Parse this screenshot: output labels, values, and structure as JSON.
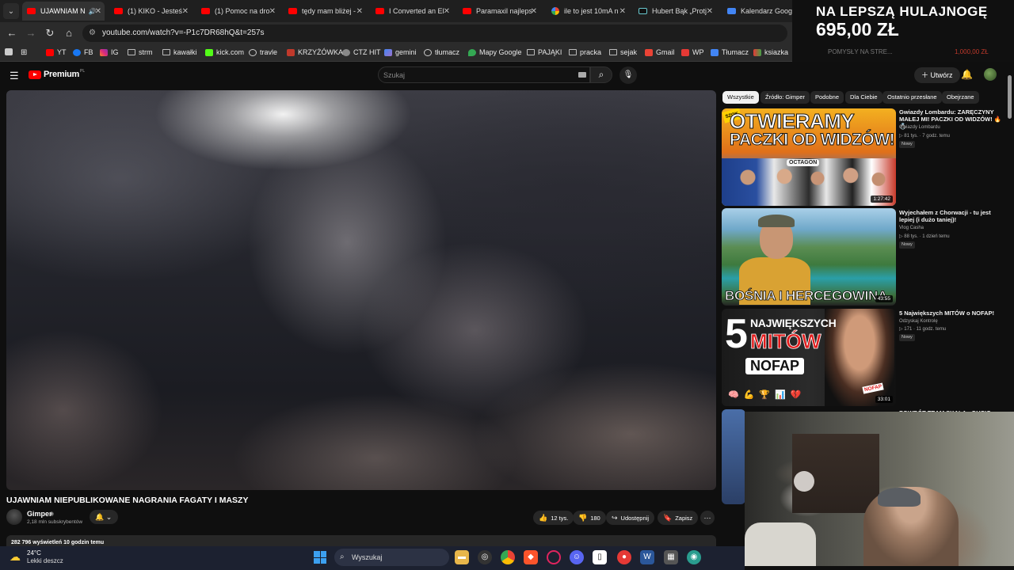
{
  "browser": {
    "tabs": [
      {
        "title": "UJAWNIAM N",
        "icon": "youtube-icon",
        "active": true
      },
      {
        "title": "(1) KIKO - Jesteś",
        "icon": "youtube-icon"
      },
      {
        "title": "(1) Pomoc na dro",
        "icon": "youtube-icon"
      },
      {
        "title": "tędy mam bliżej -",
        "icon": "youtube-icon"
      },
      {
        "title": "I Converted an El",
        "icon": "youtube-icon"
      },
      {
        "title": "Paramaxil najleps",
        "icon": "youtube-icon"
      },
      {
        "title": "ile to jest 10mA n",
        "icon": "google-icon"
      },
      {
        "title": "Hubert Bąk „Protj",
        "icon": "tiktok-icon"
      },
      {
        "title": "Kalendarz Google",
        "icon": "calendar-icon"
      }
    ],
    "url": "youtube.com/watch?v=-P1c7DR68hQ&t=257s",
    "bookmarks": [
      "YT",
      "FB",
      "IG",
      "strm",
      "kawałki",
      "kick.com",
      "travle",
      "KRZYŻÓWKA",
      "CTZ HIT",
      "gemini",
      "tłumacz",
      "Mapy Google",
      "PAJĄKI",
      "pracka",
      "sejak",
      "Gmail",
      "WP",
      "Tłumacz",
      "ksiazka"
    ]
  },
  "ad": {
    "line1": "NA LEPSZĄ HULAJNOGĘ",
    "line2": "695,00 ZŁ",
    "ghost_left": "POMYSŁY NA STRE...",
    "ghost_right": "1,000,00 ZŁ"
  },
  "youtube": {
    "logo_text": "Premium",
    "country_code": "PL",
    "search_placeholder": "Szukaj",
    "create_label": "Utwórz",
    "video": {
      "title": "UJAWNIAM NIEPUBLIKOWANE NAGRANIA FAGATY I MASZY",
      "channel": "Gimper",
      "subscribers": "2,18 mln subskrybentów",
      "likes": "12 tys.",
      "dislikes": "180",
      "share_label": "Udostępnij",
      "save_label": "Zapisz",
      "views_line": "282 796 wyświetleń  10 godzin temu"
    },
    "chips": [
      "Wszystkie",
      "Źródło: Gimper",
      "Podobne",
      "Dla Ciebie",
      "Ostatnio przesłane",
      "Obejrzane"
    ],
    "related": [
      {
        "title": "Gwiazdy Lombardu: ZARĘCZYNY MAŁEJ MI! PACZKI OD WIDZÓW! 🔥💍",
        "channel": "Gwiazdy Lombardu",
        "meta": "▷ 81 tys. · 7 godz. temu",
        "badge": "Nowy",
        "duration": "1:27:42",
        "thumb_text_1": "OTWIERAMY",
        "thumb_text_2": "PACZKI OD WIDZÓW!",
        "thumb_badge": "SZOK",
        "thumb_logo": "OCTAGON"
      },
      {
        "title": "Wyjechałem z Chorwacji - tu jest lepiej (i dużo taniej)!",
        "channel": "Vlog Casha",
        "meta": "▷ 88 tys. · 1 dzień temu",
        "badge": "Nowy",
        "duration": "43:55",
        "thumb_text": "BOŚNIA I HERCEGOWINA"
      },
      {
        "title": "5 Największych MITÓW o NOFAP!",
        "channel": "Odzyskaj Kontrolę",
        "meta": "▷ 171 · 11 godz. temu",
        "badge": "Nowy",
        "duration": "33:01",
        "thumb_number": "5",
        "thumb_text_1": "NAJWIĘKSZYCH",
        "thumb_text_2": "MITÓW",
        "thumb_text_3": "NOFAP",
        "thumb_stamp": "NOFAP"
      },
      {
        "title": "POWRÓT TEAM SKALA - GUCIO",
        "channel": "",
        "meta": ""
      }
    ]
  },
  "taskbar": {
    "temperature": "24°C",
    "weather": "Lekki deszcz",
    "search_label": "Wyszukaj"
  },
  "colors": {
    "youtube_red": "#ff0000",
    "background": "#0f0f0f",
    "chip_bg": "#272727",
    "taskbar": "#1c2130"
  }
}
